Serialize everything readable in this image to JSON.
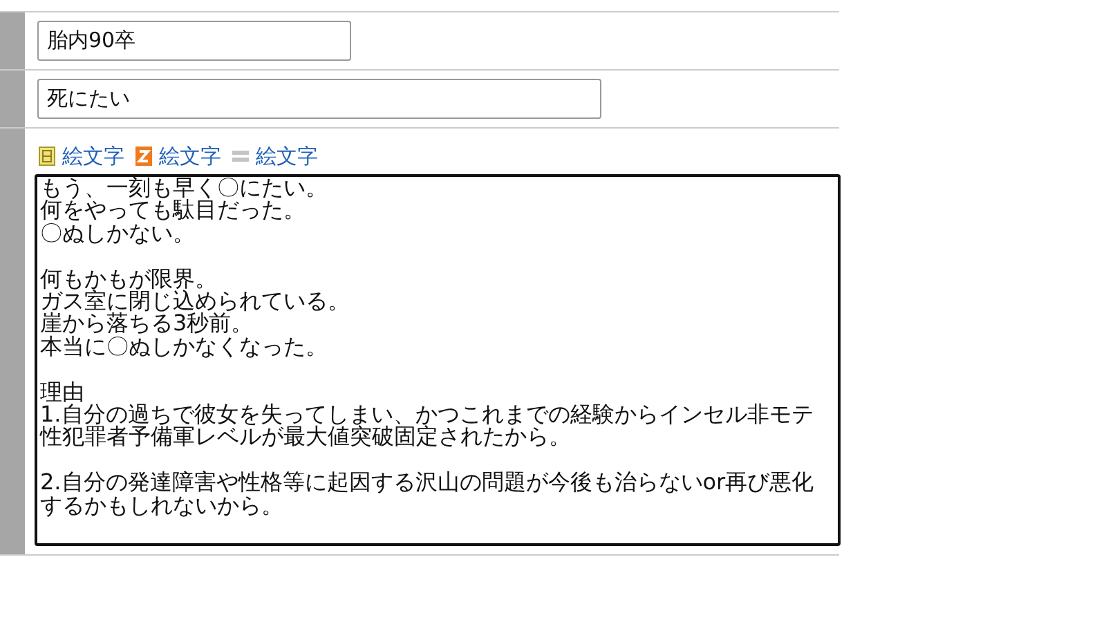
{
  "rows": [
    {
      "kind": "short",
      "value": "胎内90卒"
    },
    {
      "kind": "long",
      "value": "死にたい"
    },
    {
      "kind": "textarea",
      "links": [
        {
          "kind": "striped",
          "label": "絵文字"
        },
        {
          "kind": "z",
          "label": "絵文字"
        },
        {
          "kind": "bars",
          "label": "絵文字"
        }
      ],
      "paragraphs": [
        [
          "もう、一刻も早く〇にたい。",
          "何をやっても駄目だった。",
          "〇ぬしかない。"
        ],
        [
          "何もかもが限界。",
          "ガス室に閉じ込められている。",
          "崖から落ちる3秒前。",
          "本当に〇ぬしかなくなった。"
        ],
        [
          "理由",
          "1.自分の過ちで彼女を失ってしまい、かつこれまでの経験からインセル非モテ性犯罪者予備軍レベルが最大値突破固定されたから。"
        ],
        [
          "2.自分の発達障害や性格等に起因する沢山の問題が今後も治らないor再び悪化するかもしれないから。"
        ]
      ]
    }
  ]
}
